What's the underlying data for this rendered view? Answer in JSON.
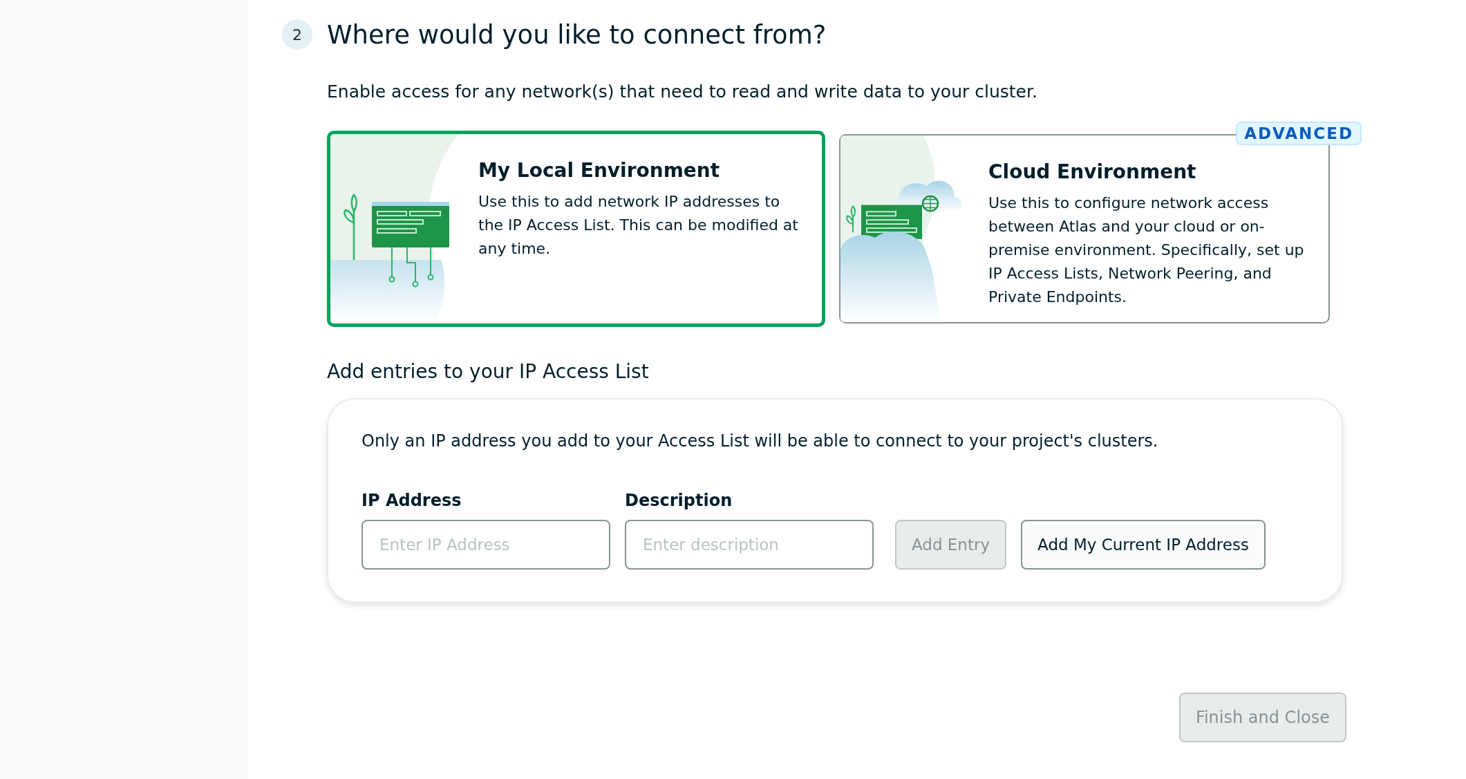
{
  "step": {
    "number": "2",
    "title": "Where would you like to connect from?"
  },
  "intro": "Enable access for any network(s) that need to read and write data to your cluster.",
  "options": [
    {
      "kind": "local",
      "title": "My Local Environment",
      "description": "Use this to add network IP addresses to the IP Access List. This can be modified at any time.",
      "selected": true
    },
    {
      "kind": "cloud",
      "title": "Cloud Environment",
      "description": "Use this to configure network access between Atlas and your cloud or on-premise environment. Specifically, set up IP Access Lists, Network Peering, and Private Endpoints.",
      "selected": false,
      "badge": "ADVANCED"
    }
  ],
  "access_list": {
    "title": "Add entries to your IP Access List",
    "note": "Only an IP address you add to your Access List will be able to connect to your project's clusters.",
    "fields": [
      {
        "label": "IP Address",
        "placeholder": "Enter IP Address"
      },
      {
        "label": "Description",
        "placeholder": "Enter description"
      }
    ],
    "buttons": [
      {
        "label": "Add Entry",
        "disabled": true
      },
      {
        "label": "Add My Current IP Address",
        "disabled": false
      }
    ]
  },
  "footer_button": {
    "label": "Finish and Close",
    "disabled": true
  }
}
